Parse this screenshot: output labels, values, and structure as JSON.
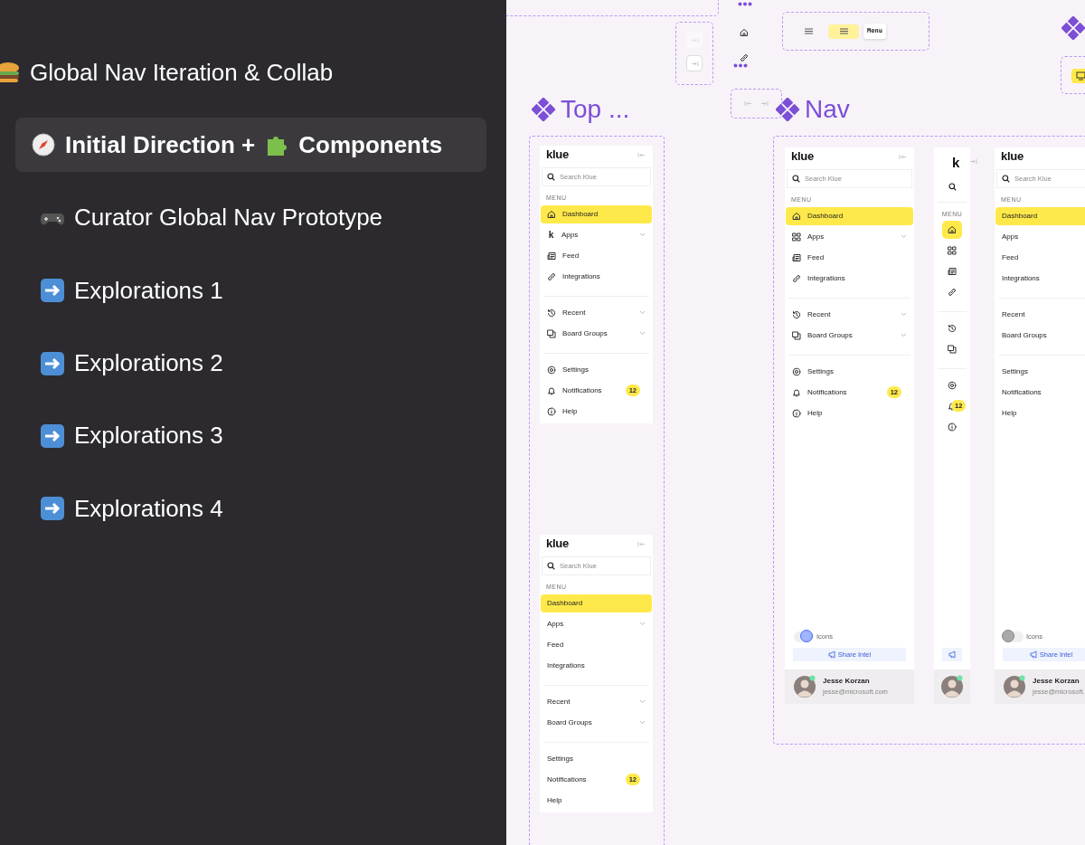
{
  "pages": [
    {
      "label": "Global Nav Iteration & Collab",
      "selected": false,
      "children": [
        {
          "label": "Initial Direction +",
          "label_after": "Components",
          "selected": true
        },
        {
          "label": "Curator Global Nav Prototype",
          "selected": false
        },
        {
          "label": "Explorations 1",
          "selected": false
        },
        {
          "label": "Explorations 2",
          "selected": false
        },
        {
          "label": "Explorations 3",
          "selected": false
        },
        {
          "label": "Explorations 4",
          "selected": false
        }
      ]
    }
  ],
  "canvas": {
    "collapse_buttons": [
      {
        "disabled": true
      },
      {
        "disabled": false
      }
    ],
    "menu_buttons": [
      {
        "selected": false
      },
      {
        "selected": true
      }
    ],
    "menu_tooltip": "Menu",
    "frames": [
      {
        "title": "Top ...",
        "cards": [
          {
            "kind": "icons",
            "logo": "klue",
            "search_placeholder": "Search Klue",
            "section_label": "MENU",
            "groups": [
              [
                {
                  "label": "Dashboard",
                  "selected": true,
                  "expandable": false
                },
                {
                  "icon_char": "k",
                  "label": "Apps",
                  "selected": false,
                  "expandable": true
                },
                {
                  "label": "Feed",
                  "selected": false,
                  "expandable": false
                },
                {
                  "label": "Integrations",
                  "selected": false,
                  "expandable": false
                }
              ],
              [
                {
                  "label": "Recent",
                  "selected": false,
                  "expandable": true
                },
                {
                  "label": "Board Groups",
                  "selected": false,
                  "expandable": true
                }
              ],
              [
                {
                  "label": "Settings",
                  "selected": false,
                  "expandable": false
                },
                {
                  "label": "Notifications",
                  "selected": false,
                  "expandable": false,
                  "badge": "12"
                },
                {
                  "label": "Help",
                  "selected": false,
                  "expandable": false
                }
              ]
            ]
          },
          {
            "kind": "text",
            "logo": "klue",
            "search_placeholder": "Search Klue",
            "section_label": "MENU",
            "groups": [
              [
                {
                  "label": "Dashboard",
                  "selected": true,
                  "expandable": false
                },
                {
                  "label": "Apps",
                  "selected": false,
                  "expandable": true
                },
                {
                  "label": "Feed",
                  "selected": false,
                  "expandable": false
                },
                {
                  "label": "Integrations",
                  "selected": false,
                  "expandable": false
                }
              ],
              [
                {
                  "label": "Recent",
                  "selected": false,
                  "expandable": true
                },
                {
                  "label": "Board Groups",
                  "selected": false,
                  "expandable": true
                }
              ],
              [
                {
                  "label": "Settings",
                  "selected": false,
                  "expandable": false
                },
                {
                  "label": "Notifications",
                  "selected": false,
                  "expandable": false,
                  "badge": "12"
                },
                {
                  "label": "Help",
                  "selected": false,
                  "expandable": false
                }
              ]
            ]
          }
        ]
      },
      {
        "title": "Nav",
        "cards": [
          {
            "kind": "icons",
            "logo": "klue",
            "search_placeholder": "Search Klue",
            "section_label": "MENU",
            "groups": [
              [
                {
                  "label": "Dashboard",
                  "selected": true,
                  "expandable": false
                },
                {
                  "label": "Apps",
                  "selected": false,
                  "expandable": true
                },
                {
                  "label": "Feed",
                  "selected": false,
                  "expandable": false
                },
                {
                  "label": "Integrations",
                  "selected": false,
                  "expandable": false
                }
              ],
              [
                {
                  "label": "Recent",
                  "selected": false,
                  "expandable": true
                },
                {
                  "label": "Board Groups",
                  "selected": false,
                  "expandable": true
                }
              ],
              [
                {
                  "label": "Settings",
                  "selected": false,
                  "expandable": false
                },
                {
                  "label": "Notifications",
                  "selected": false,
                  "expandable": false,
                  "badge": "12"
                },
                {
                  "label": "Help",
                  "selected": false,
                  "expandable": false
                }
              ]
            ],
            "toggle": {
              "label": "Icons",
              "on": true
            },
            "share": "Share Intel",
            "user": {
              "name": "Jesse Korzan",
              "email": "jesse@microsoft.com"
            }
          },
          {
            "kind": "collapsed",
            "logo": "k",
            "section_label": "MENU",
            "groups": [
              [
                {
                  "selected": true
                },
                {
                  "selected": false
                },
                {
                  "selected": false
                },
                {
                  "selected": false
                }
              ],
              [
                {
                  "selected": false
                },
                {
                  "selected": false
                }
              ],
              [
                {
                  "selected": false
                },
                {
                  "selected": false,
                  "badge": "12"
                },
                {
                  "selected": false
                }
              ]
            ]
          },
          {
            "kind": "text",
            "logo": "klue",
            "search_placeholder": "Search Klue",
            "section_label": "MENU",
            "groups": [
              [
                {
                  "label": "Dashboard",
                  "selected": true
                },
                {
                  "label": "Apps",
                  "selected": false
                },
                {
                  "label": "Feed",
                  "selected": false
                },
                {
                  "label": "Integrations",
                  "selected": false
                }
              ],
              [
                {
                  "label": "Recent",
                  "selected": false
                },
                {
                  "label": "Board Groups",
                  "selected": false
                }
              ],
              [
                {
                  "label": "Settings",
                  "selected": false
                },
                {
                  "label": "Notifications",
                  "selected": false
                },
                {
                  "label": "Help",
                  "selected": false
                }
              ]
            ],
            "toggle": {
              "label": "Icons",
              "on": false
            },
            "share": "Share Intel",
            "user": {
              "name": "Jesse Korzan",
              "email": "jesse@microsoft."
            }
          }
        ]
      }
    ]
  }
}
